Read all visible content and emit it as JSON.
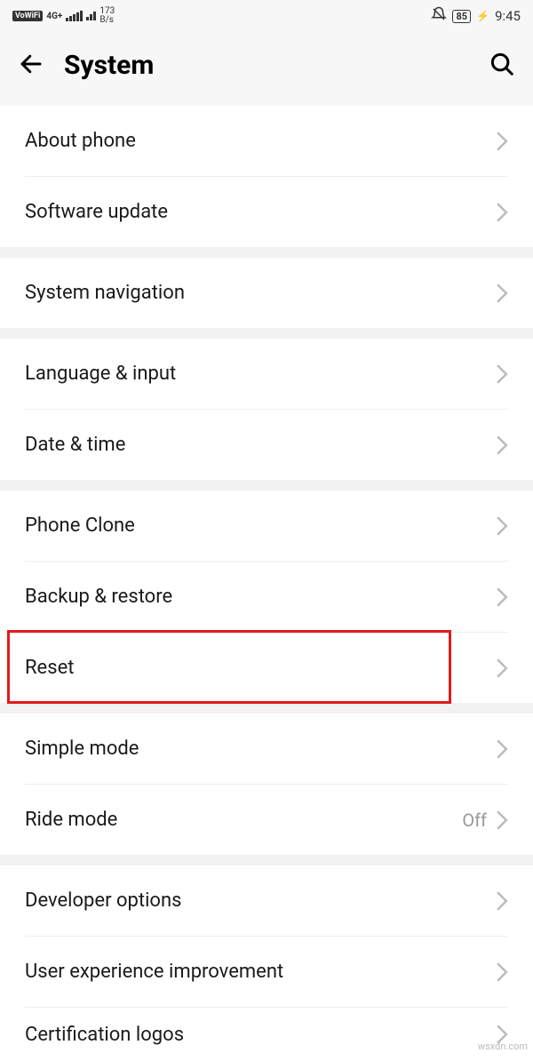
{
  "status": {
    "vowifi": "VoWiFi",
    "network_type": "4G+",
    "net_speed_value": "173",
    "net_speed_unit": "B/s",
    "battery": "85",
    "time": "9:45"
  },
  "header": {
    "title": "System"
  },
  "groups": [
    {
      "items": [
        {
          "key": "about-phone",
          "label": "About phone"
        },
        {
          "key": "software-update",
          "label": "Software update"
        }
      ]
    },
    {
      "items": [
        {
          "key": "system-navigation",
          "label": "System navigation"
        }
      ]
    },
    {
      "items": [
        {
          "key": "language-input",
          "label": "Language & input"
        },
        {
          "key": "date-time",
          "label": "Date & time"
        }
      ]
    },
    {
      "items": [
        {
          "key": "phone-clone",
          "label": "Phone Clone"
        },
        {
          "key": "backup-restore",
          "label": "Backup & restore"
        },
        {
          "key": "reset",
          "label": "Reset",
          "highlighted": true
        }
      ]
    },
    {
      "items": [
        {
          "key": "simple-mode",
          "label": "Simple mode"
        },
        {
          "key": "ride-mode",
          "label": "Ride mode",
          "value": "Off"
        }
      ]
    },
    {
      "items": [
        {
          "key": "developer-options",
          "label": "Developer options"
        },
        {
          "key": "user-experience-improvement",
          "label": "User experience improvement"
        },
        {
          "key": "certification-logos",
          "label": "Certification logos"
        }
      ]
    }
  ],
  "watermark": "wsxdn.com"
}
